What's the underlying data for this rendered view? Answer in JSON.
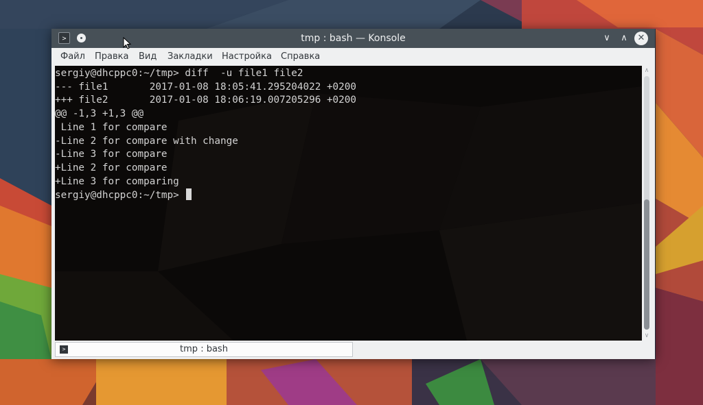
{
  "window": {
    "title": "tmp : bash — Konsole",
    "app_icon_glyph": ">",
    "controls": {
      "minimize": "∨",
      "maximize": "∧",
      "close": "✕"
    }
  },
  "menu": {
    "items": [
      {
        "label": "Файл"
      },
      {
        "label": "Правка"
      },
      {
        "label": "Вид"
      },
      {
        "label": "Закладки"
      },
      {
        "label": "Настройка"
      },
      {
        "label": "Справка"
      }
    ]
  },
  "terminal": {
    "lines": [
      "sergiy@dhcppc0:~/tmp> diff  -u file1 file2",
      "--- file1       2017-01-08 18:05:41.295204022 +0200",
      "+++ file2       2017-01-08 18:06:19.007205296 +0200",
      "@@ -1,3 +1,3 @@",
      " Line 1 for compare",
      "-Line 2 for compare with change",
      "-Line 3 for compare",
      "+Line 2 for compare",
      "+Line 3 for comparing"
    ],
    "prompt": "sergiy@dhcppc0:~/tmp> "
  },
  "scrollbar": {
    "up": "∧",
    "down": "∨"
  },
  "tab": {
    "icon_glyph": ">",
    "label": "tmp : bash"
  },
  "icons": {
    "app": "konsole-icon",
    "pin": "pin-icon",
    "minimize": "chevron-down-icon",
    "maximize": "chevron-up-icon",
    "close": "close-icon",
    "pointer": "mouse-pointer-icon"
  },
  "colors": {
    "titlebar": "#475057",
    "window_bg": "#eff0f1",
    "terminal_bg": "#0b0908",
    "terminal_fg": "#d3d3d3"
  }
}
